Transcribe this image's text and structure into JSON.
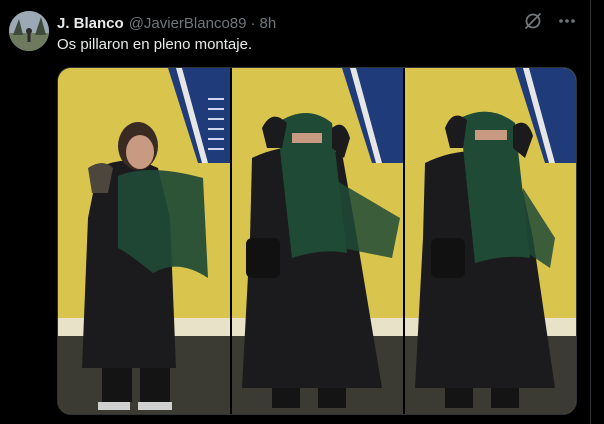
{
  "post": {
    "author_name": "J. Blanco",
    "handle": "@JavierBlanco89",
    "separator": "·",
    "time": "8h",
    "text": "Os pillaron en pleno montaje."
  },
  "icons": {
    "avatar": "avatar-icon",
    "grok": "grok-icon",
    "more": "more-icon"
  },
  "media": {
    "photos": [
      {
        "description_name": "photo-1"
      },
      {
        "description_name": "photo-2"
      },
      {
        "description_name": "photo-3"
      }
    ]
  },
  "colors": {
    "background": "#000000",
    "text": "#e7e9ea",
    "muted": "#71767b",
    "wall": "#d9c54d",
    "sign": "#1f3b7a",
    "scarf": "#1f4a36",
    "coat": "#1b1b1d"
  }
}
